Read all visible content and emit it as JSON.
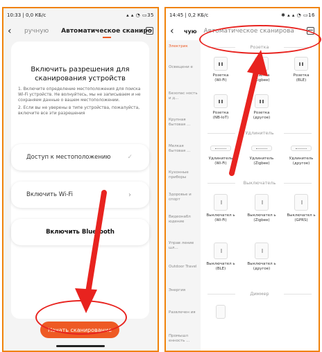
{
  "left": {
    "status": {
      "time": "10:33 | 0,0 КБ/с",
      "right": "35"
    },
    "header": {
      "tab_prev": "ручную",
      "tab_current": "Автоматическое сканиро"
    },
    "card": {
      "title": "Включить разрешения для сканирования устройств",
      "note1": "1. Включите определение местоположения для поиска Wi-Fi устройств. Не волнуйтесь, мы не записываем и не сохраняем данные о вашем местоположении.",
      "note2": "2. Если вы не уверены в типе устройства, пожалуйста, включите все эти разрешения"
    },
    "buttons": {
      "location": "Доступ к местоположению",
      "location_check": "✓",
      "wifi": "Включить Wi-Fi",
      "wifi_arrow": "›",
      "bluetooth": "Включить Bluetooth"
    },
    "start_button": "Начать сканирование"
  },
  "right": {
    "status": {
      "time": "14:45 | 0,2 КБ/с",
      "right": "16"
    },
    "header": {
      "tab_prev": "чую",
      "tab_current": "Автоматическое сканирова"
    },
    "sidebar": [
      "Электрик",
      "Освещени е",
      "Безопас ность и д...",
      "Крупная бытовая ...",
      "Мелкая бытовая ...",
      "Кухонные приборы",
      "Здоровье и спорт",
      "Видеонабл юдение",
      "Управ ление шл...",
      "Outdoor Travel",
      "Энергия",
      "Развлечен ия",
      "Промышл енность ..."
    ],
    "sections": {
      "outlet": "Розетка",
      "strip": "Удлинитель",
      "switch": "Выключатель",
      "dimmer": "Диммер"
    },
    "outlets": [
      {
        "name": "Розетка",
        "sub": "(Wi-Fi)"
      },
      {
        "name": "Розетка",
        "sub": "(Zigbee)"
      },
      {
        "name": "Розетка",
        "sub": "(BLE)"
      },
      {
        "name": "Розетка",
        "sub": "(NB-IoT)"
      },
      {
        "name": "Розетка",
        "sub": "(другое)"
      }
    ],
    "strips": [
      {
        "name": "Удлинитель",
        "sub": "(Wi-Fi)"
      },
      {
        "name": "Удлинитель",
        "sub": "(Zigbee)"
      },
      {
        "name": "Удлинитель",
        "sub": "(другое)"
      }
    ],
    "switches": [
      {
        "name": "Выключател ь",
        "sub": "(Wi-Fi)"
      },
      {
        "name": "Выключател ь",
        "sub": "(Zigbee)"
      },
      {
        "name": "Выключател ь",
        "sub": "(GPRS)"
      },
      {
        "name": "Выключател ь",
        "sub": "(BLE)"
      },
      {
        "name": "Выключател ь",
        "sub": "(другое)"
      }
    ]
  },
  "colors": {
    "accent": "#ee5a24",
    "annotation": "#e8231f",
    "frame": "#f0820a"
  }
}
